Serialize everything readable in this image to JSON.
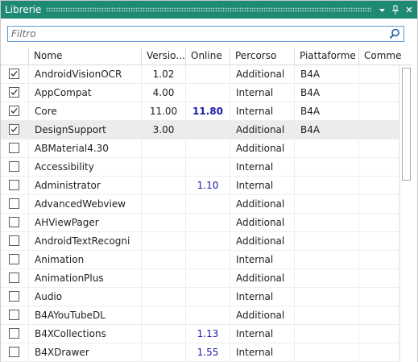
{
  "panel": {
    "title": "Librerie",
    "menu_icon": "chevron-down-icon",
    "pin_icon": "pin-icon",
    "close_icon": "close-icon"
  },
  "search": {
    "placeholder": "Filtro",
    "value": "",
    "icon": "search-icon"
  },
  "columns": {
    "name": "Nome",
    "version": "Versio...",
    "online": "Online",
    "path": "Percorso",
    "platform": "Piattaforme",
    "comment": "Comme"
  },
  "rows": [
    {
      "checked": true,
      "name": "AndroidVisionOCR",
      "version": "1.02",
      "online": "",
      "path": "Additional",
      "platform": "B4A"
    },
    {
      "checked": true,
      "name": "AppCompat",
      "version": "4.00",
      "online": "",
      "path": "Internal",
      "platform": "B4A"
    },
    {
      "checked": true,
      "name": "Core",
      "version": "11.00",
      "online": "11.80",
      "path": "Internal",
      "platform": "B4A",
      "online_bold": true
    },
    {
      "checked": true,
      "name": "DesignSupport",
      "version": "3.00",
      "online": "",
      "path": "Additional",
      "platform": "B4A",
      "selected": true
    },
    {
      "checked": false,
      "name": "ABMaterial4.30",
      "version": "",
      "online": "",
      "path": "Additional",
      "platform": ""
    },
    {
      "checked": false,
      "name": "Accessibility",
      "version": "",
      "online": "",
      "path": "Internal",
      "platform": ""
    },
    {
      "checked": false,
      "name": "Administrator",
      "version": "",
      "online": "1.10",
      "path": "Internal",
      "platform": ""
    },
    {
      "checked": false,
      "name": "AdvancedWebview",
      "version": "",
      "online": "",
      "path": "Additional",
      "platform": ""
    },
    {
      "checked": false,
      "name": "AHViewPager",
      "version": "",
      "online": "",
      "path": "Additional",
      "platform": ""
    },
    {
      "checked": false,
      "name": "AndroidTextRecogni",
      "version": "",
      "online": "",
      "path": "Additional",
      "platform": ""
    },
    {
      "checked": false,
      "name": "Animation",
      "version": "",
      "online": "",
      "path": "Internal",
      "platform": ""
    },
    {
      "checked": false,
      "name": "AnimationPlus",
      "version": "",
      "online": "",
      "path": "Additional",
      "platform": ""
    },
    {
      "checked": false,
      "name": "Audio",
      "version": "",
      "online": "",
      "path": "Internal",
      "platform": ""
    },
    {
      "checked": false,
      "name": "B4AYouTubeDL",
      "version": "",
      "online": "",
      "path": "Additional",
      "platform": ""
    },
    {
      "checked": false,
      "name": "B4XCollections",
      "version": "",
      "online": "1.13",
      "path": "Internal",
      "platform": ""
    },
    {
      "checked": false,
      "name": "B4XDrawer",
      "version": "",
      "online": "1.55",
      "path": "Internal",
      "platform": ""
    }
  ],
  "colors": {
    "titlebar": "#1e8a73",
    "online_text": "#1a1aa8",
    "selected_row": "#ececec",
    "search_border": "#5d9bd0"
  }
}
